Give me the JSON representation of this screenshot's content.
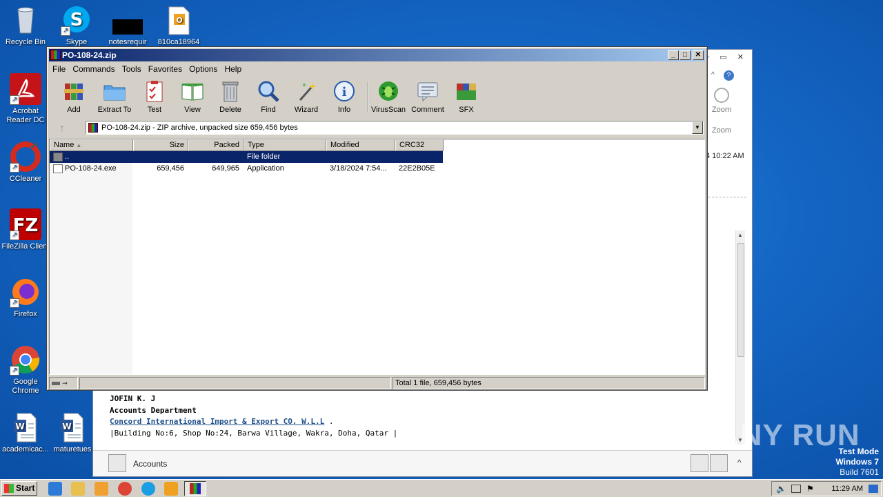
{
  "desktop": {
    "icons": [
      {
        "label": "Recycle Bin"
      },
      {
        "label": "Skype"
      },
      {
        "label": "notesrequir"
      },
      {
        "label": "810ca18964"
      },
      {
        "label": "Acrobat Reader DC"
      },
      {
        "label": "CCleaner"
      },
      {
        "label": "FileZilla Client"
      },
      {
        "label": "Firefox"
      },
      {
        "label": "Google Chrome"
      },
      {
        "label": "academicac..."
      },
      {
        "label": "maturetues"
      }
    ]
  },
  "outlook": {
    "zoom_label_top": "Zoom",
    "zoom_label_bottom": "Zoom",
    "time_fragment": "4 10:22 AM",
    "signature": {
      "name": "JOFIN K. J",
      "dept": "Accounts  Department",
      "company": "Concord International Import & Export CO. W.L.L",
      "company_suffix": " .",
      "address": "|Building No:6, Shop No:24, Barwa Village, Wakra, Doha, Qatar |"
    },
    "people_label": "Accounts"
  },
  "winrar": {
    "title": "PO-108-24.zip",
    "menu": [
      "File",
      "Commands",
      "Tools",
      "Favorites",
      "Options",
      "Help"
    ],
    "toolbar": [
      {
        "label": "Add",
        "icon": "add-icon"
      },
      {
        "label": "Extract To",
        "icon": "extract-folder-icon"
      },
      {
        "label": "Test",
        "icon": "test-clipboard-icon"
      },
      {
        "label": "View",
        "icon": "view-book-icon"
      },
      {
        "label": "Delete",
        "icon": "trash-icon"
      },
      {
        "label": "Find",
        "icon": "magnifier-icon"
      },
      {
        "label": "Wizard",
        "icon": "wand-icon"
      },
      {
        "label": "Info",
        "icon": "info-icon"
      },
      {
        "label": "VirusScan",
        "icon": "bug-icon"
      },
      {
        "label": "Comment",
        "icon": "comment-icon"
      },
      {
        "label": "SFX",
        "icon": "sfx-books-icon"
      }
    ],
    "address": "PO-108-24.zip - ZIP archive, unpacked size 659,456 bytes",
    "columns": [
      "Name",
      "Size",
      "Packed",
      "Type",
      "Modified",
      "CRC32"
    ],
    "rows": [
      {
        "name": "..",
        "size": "",
        "packed": "",
        "type": "File folder",
        "modified": "",
        "crc": "",
        "selected": true
      },
      {
        "name": "PO-108-24.exe",
        "size": "659,456",
        "packed": "649,965",
        "type": "Application",
        "modified": "3/18/2024 7:54...",
        "crc": "22E2B05E",
        "selected": false
      }
    ],
    "status": "Total 1 file, 659,456 bytes"
  },
  "watermark": {
    "text": "ANY RUN",
    "mode_line1": "Test Mode",
    "mode_line2": "Windows 7",
    "mode_line3": "Build 7601"
  },
  "taskbar": {
    "start": "Start",
    "clock": "11:29 AM"
  },
  "colors": {
    "desktop_blue": "#1466c4",
    "winrar_title": "#0a246a",
    "selection": "#0a246a"
  }
}
